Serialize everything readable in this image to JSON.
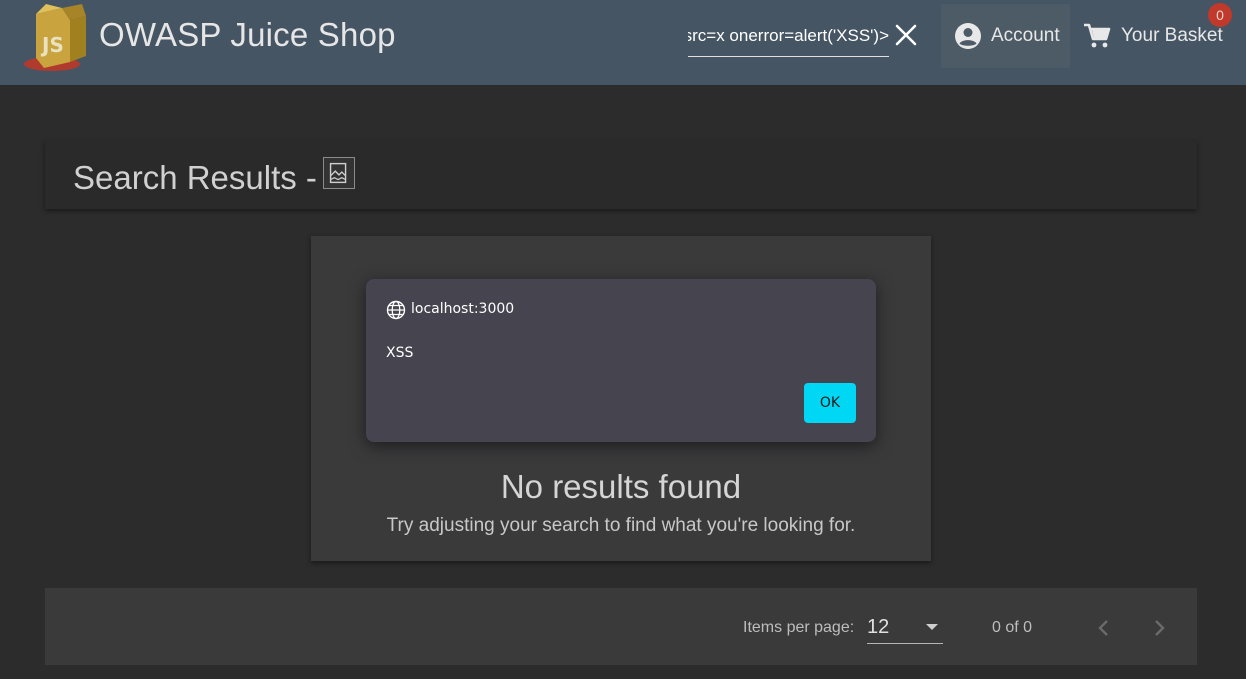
{
  "toolbar": {
    "app_title": "OWASP Juice Shop",
    "search_value": "<img src=x onerror=alert('XSS')>",
    "account_label": "Account",
    "basket_label": "Your Basket",
    "basket_count": "0",
    "icons": {
      "logo": "juice-carton-logo",
      "clear": "close-icon",
      "account": "account-circle-icon",
      "basket": "shopping-cart-icon"
    }
  },
  "main": {
    "heading": "Search Results -",
    "heading_image": "broken-image-icon",
    "no_results_title": "No results found",
    "no_results_subtitle": "Try adjusting your search to find what you're looking for."
  },
  "paginator": {
    "items_per_page_label": "Items per page:",
    "items_per_page_value": "12",
    "range_label": "0 of 0"
  },
  "alert": {
    "origin": "localhost:3000",
    "message": "XSS",
    "ok_label": "OK"
  },
  "colors": {
    "toolbar": "#455563",
    "background": "#2c2c2d",
    "card": "#3a3a3b",
    "dialog": "#45444f",
    "ok_button": "#00d7f4",
    "badge": "#c0392b"
  }
}
